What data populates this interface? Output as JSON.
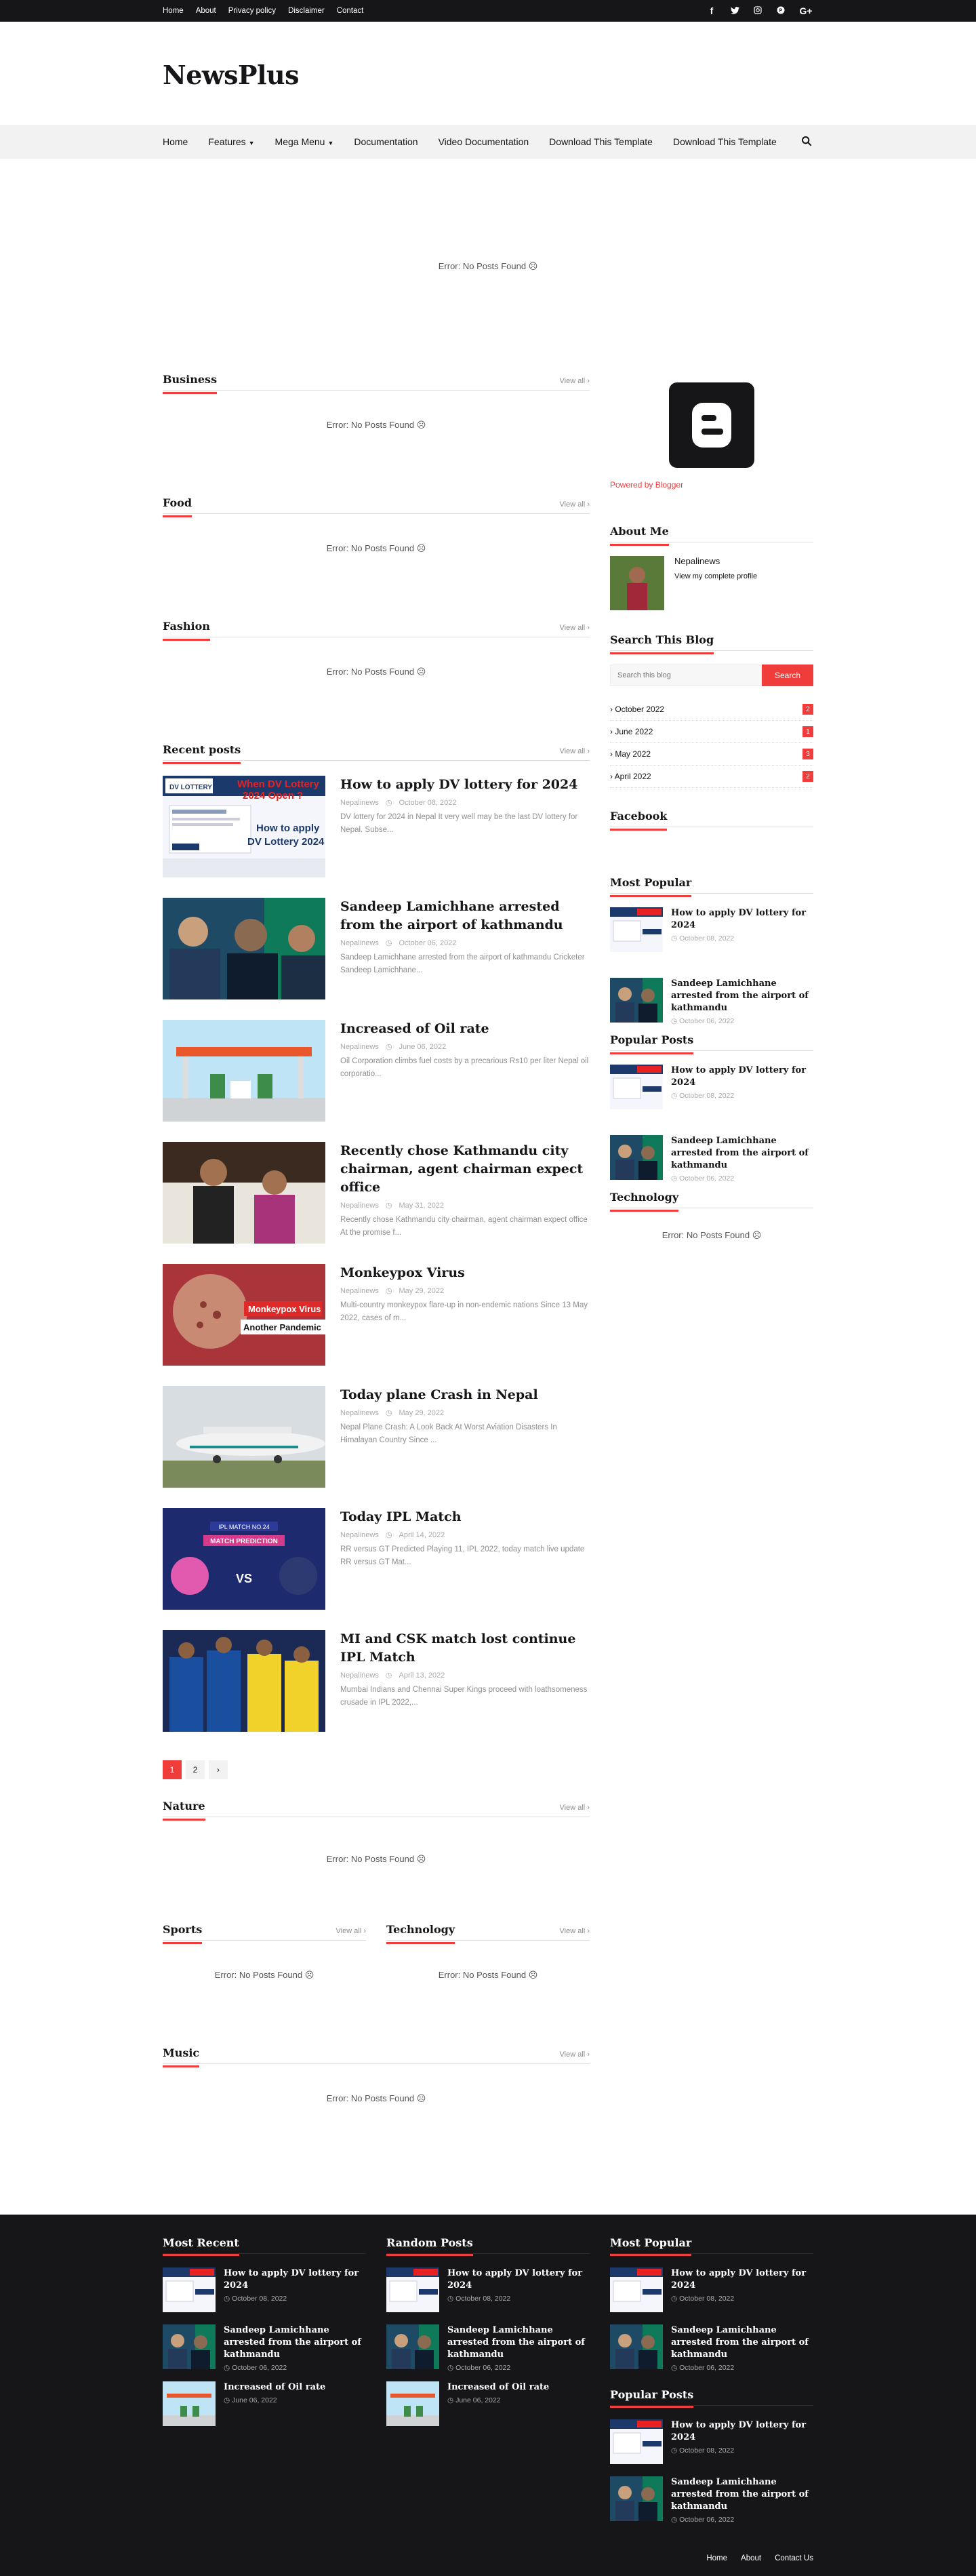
{
  "topbar": {
    "menu": [
      "Home",
      "About",
      "Privacy policy",
      "Disclaimer",
      "Contact"
    ],
    "social": [
      "f",
      "t",
      "ig",
      "p",
      "G+"
    ]
  },
  "header": {
    "logo": "NewsPlus"
  },
  "nav": {
    "items": [
      {
        "label": "Home",
        "caret": false
      },
      {
        "label": "Features",
        "caret": true
      },
      {
        "label": "Mega Menu",
        "caret": true
      },
      {
        "label": "Documentation",
        "caret": false
      },
      {
        "label": "Video Documentation",
        "caret": false
      },
      {
        "label": "Download This Template",
        "caret": false
      },
      {
        "label": "Download This Template",
        "caret": false
      }
    ]
  },
  "error_text": "Error: No Posts Found",
  "view_all": "View all",
  "sections": {
    "business": "Business",
    "food": "Food",
    "fashion": "Fashion",
    "recent": "Recent posts",
    "nature": "Nature",
    "sports": "Sports",
    "technology": "Technology",
    "music": "Music"
  },
  "recent_posts": [
    {
      "title": "How to apply DV lottery for 2024",
      "author": "Nepalinews",
      "date": "October 08, 2022",
      "snippet": "DV lottery for 2024 in Nepal It very well may be the last DV lottery for Nepal. Subse..."
    },
    {
      "title": "Sandeep Lamichhane arrested from the airport of kathmandu",
      "author": "Nepalinews",
      "date": "October 06, 2022",
      "snippet": "Sandeep Lamichhane arrested from the airport of kathmandu Cricketer Sandeep Lamichhane..."
    },
    {
      "title": "Increased of Oil rate",
      "author": "Nepalinews",
      "date": "June 06, 2022",
      "snippet": "Oil Corporation climbs fuel costs by a precarious Rs10 per liter Nepal oil corporatio..."
    },
    {
      "title": "Recently chose Kathmandu city chairman, agent chairman expect office",
      "author": "Nepalinews",
      "date": "May 31, 2022",
      "snippet": "Recently chose Kathmandu city chairman, agent chairman expect office At the promise f..."
    },
    {
      "title": "Monkeypox Virus",
      "author": "Nepalinews",
      "date": "May 29, 2022",
      "snippet": "Multi-country monkeypox flare-up in non-endemic nations Since 13 May 2022, cases of m..."
    },
    {
      "title": "Today plane Crash in Nepal",
      "author": "Nepalinews",
      "date": "May 29, 2022",
      "snippet": "Nepal Plane Crash: A Look Back At Worst Aviation Disasters In Himalayan Country Since ..."
    },
    {
      "title": "Today IPL Match",
      "author": "Nepalinews",
      "date": "April 14, 2022",
      "snippet": "RR versus GT Predicted Playing 11, IPL 2022, today match live update RR versus GT Mat..."
    },
    {
      "title": "MI and CSK match lost continue IPL Match",
      "author": "Nepalinews",
      "date": "April 13, 2022",
      "snippet": "Mumbai Indians and Chennai Super Kings proceed with loathsomeness crusade in IPL 2022,..."
    }
  ],
  "thumb_labels": {
    "dv1": "When DV Lottery",
    "dv2": "2024 Open ?",
    "dv3": "How to apply",
    "dv4": "DV Lottery 2024",
    "dvlogo": "DV LOTTERY",
    "monkey1": "Monkeypox Virus",
    "monkey2": "Another Pandemic",
    "ipl1": "IPL MATCH NO.24",
    "ipl2": "MATCH PREDICTION",
    "ipl3": "VS"
  },
  "pager": [
    "1",
    "2",
    "›"
  ],
  "sidebar": {
    "powered": "Powered by Blogger",
    "about_title": "About Me",
    "about_name": "Nepalinews",
    "about_link": "View my complete profile",
    "search_title": "Search This Blog",
    "search_placeholder": "Search this blog",
    "search_button": "Search",
    "archive": [
      {
        "label": "October 2022",
        "count": "2"
      },
      {
        "label": "June 2022",
        "count": "1"
      },
      {
        "label": "May 2022",
        "count": "3"
      },
      {
        "label": "April 2022",
        "count": "2"
      }
    ],
    "facebook_title": "Facebook",
    "most_popular_title": "Most Popular",
    "popular_posts_title": "Popular Posts",
    "technology_title": "Technology",
    "popular": [
      {
        "title": "How to apply DV lottery for 2024",
        "date": "October 08, 2022"
      },
      {
        "title": "Sandeep Lamichhane arrested from the airport of kathmandu",
        "date": "October 06, 2022"
      }
    ]
  },
  "footer": {
    "most_recent": "Most Recent",
    "random_posts": "Random Posts",
    "most_popular": "Most Popular",
    "popular_posts": "Popular Posts",
    "items": [
      {
        "title": "How to apply DV lottery for 2024",
        "date": "October 08, 2022"
      },
      {
        "title": "Sandeep Lamichhane arrested from the airport of kathmandu",
        "date": "October 06, 2022"
      },
      {
        "title": "Increased of Oil rate",
        "date": "June 06, 2022"
      }
    ],
    "menu": [
      "Home",
      "About",
      "Contact Us"
    ]
  },
  "colors": {
    "accent": "#f13c3c",
    "dark": "#161619",
    "nav_bg": "#f2f2f2"
  }
}
